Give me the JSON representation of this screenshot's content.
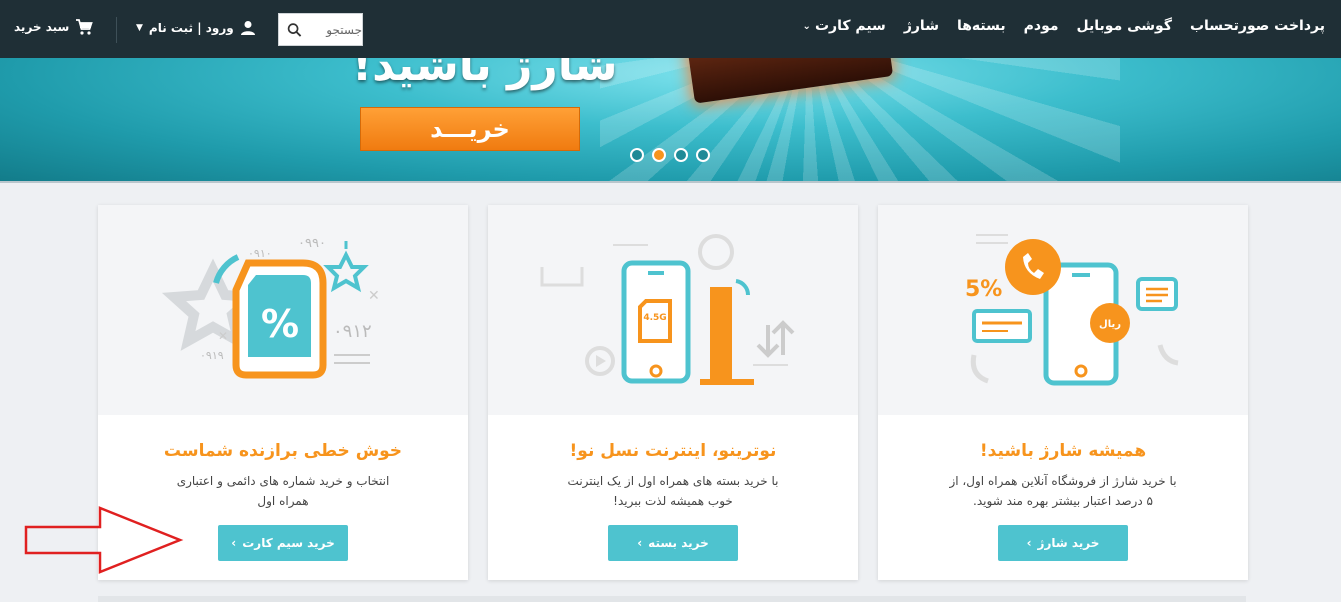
{
  "nav": {
    "items": [
      {
        "label": "سیم کارت",
        "has_dropdown": true
      },
      {
        "label": "شارژ"
      },
      {
        "label": "بسته‌ها"
      },
      {
        "label": "مودم"
      },
      {
        "label": "گوشی موبایل"
      },
      {
        "label": "پرداخت صورتحساب"
      }
    ],
    "search_placeholder": "جستجو",
    "login_label": "ورود | ثبت نام",
    "cart_label": "سبد خرید"
  },
  "hero": {
    "title": "شارژ باشید!",
    "button_label": "خریـــد",
    "slides": 4,
    "active_slide": 2
  },
  "cards": [
    {
      "title": "خوش خطی برازنده شماست",
      "description": "انتخاب و خرید شماره های دائمی و اعتباری همراه اول",
      "button_label": "خرید سیم کارت",
      "illustration_text": {
        "percent": "%",
        "n1": "۰۹۱۰",
        "n2": "۰۹۹۰",
        "n3": "۰۹۱۲",
        "n4": "۰۹۱۹"
      }
    },
    {
      "title": "نوترینو، اینترنت نسل نو!",
      "description": "با خرید بسته های همراه اول از یک اینترنت خوب همیشه لذت ببرید!",
      "button_label": "خرید بسته",
      "illustration_text": {
        "sim": "4.5G"
      }
    },
    {
      "title": "همیشه شارژ باشید!",
      "description": "با خرید شارژ از فروشگاه آنلاین همراه اول، از ۵ درصد اعتبار بیشتر بهره مند شوید.",
      "button_label": "خرید شارژ",
      "illustration_text": {
        "percent": "5%",
        "coin": "ریال"
      }
    }
  ],
  "colors": {
    "accent_orange": "#f7941d",
    "accent_teal": "#4ec3cf",
    "nav_bg": "#1f2f36",
    "annotation_arrow": "#e02020"
  }
}
